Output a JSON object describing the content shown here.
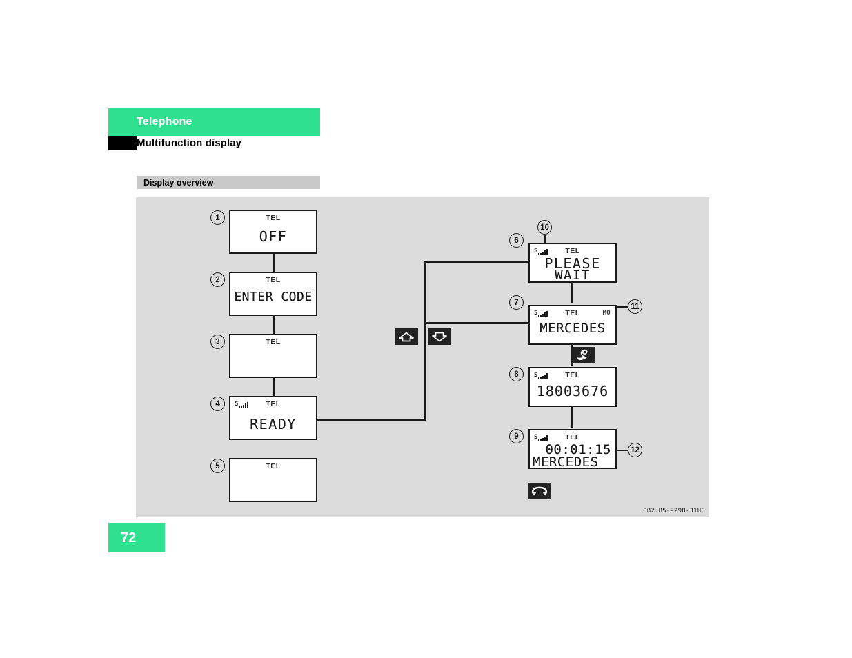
{
  "header": {
    "chapter": "Telephone",
    "section": "Multifunction display"
  },
  "section_bar": {
    "label": "Display overview"
  },
  "figure": {
    "code": "P82.85-9298-31US"
  },
  "page": {
    "number": "72"
  },
  "displays": [
    {
      "callout": "1",
      "tel": "TEL",
      "signal": false,
      "mo": "",
      "line1": "OFF",
      "line2": ""
    },
    {
      "callout": "2",
      "tel": "TEL",
      "signal": false,
      "mo": "",
      "line1": "ENTER CODE",
      "line2": ""
    },
    {
      "callout": "3",
      "tel": "TEL",
      "signal": false,
      "mo": "",
      "line1": "",
      "line2": ""
    },
    {
      "callout": "4",
      "tel": "TEL",
      "signal": true,
      "mo": "",
      "line1": "READY",
      "line2": ""
    },
    {
      "callout": "5",
      "tel": "TEL",
      "signal": false,
      "mo": "",
      "line1": "",
      "line2": ""
    },
    {
      "callout": "6",
      "tel": "TEL",
      "signal": true,
      "mo": "",
      "line1": "PLEASE",
      "line2": "WAIT"
    },
    {
      "callout": "7",
      "tel": "TEL",
      "signal": true,
      "mo": "MO",
      "line1": "MERCEDES",
      "line2": ""
    },
    {
      "callout": "8",
      "tel": "TEL",
      "signal": true,
      "mo": "",
      "line1": "18003676",
      "line2": ""
    },
    {
      "callout": "9",
      "tel": "TEL",
      "signal": true,
      "mo": "",
      "line1": "00:01:15",
      "line2": "MERCEDES"
    }
  ],
  "leader_callouts": [
    {
      "number": "10",
      "target": "signal-strength-indicator"
    },
    {
      "number": "11",
      "target": "mo-network-indicator"
    },
    {
      "number": "12",
      "target": "call-duration-timer"
    }
  ],
  "key_icons": [
    {
      "name": "up-arrow-key",
      "glyph": "arrow-up"
    },
    {
      "name": "down-arrow-key",
      "glyph": "arrow-down"
    },
    {
      "name": "accept-call-key",
      "glyph": "handset-pickup"
    },
    {
      "name": "end-call-key",
      "glyph": "handset-hangup"
    }
  ],
  "colors": {
    "brand_green": "#2ee08f",
    "canvas_gray": "#dcdcdc",
    "bar_gray": "#c9c9c9",
    "ink": "#1a1a1a"
  }
}
